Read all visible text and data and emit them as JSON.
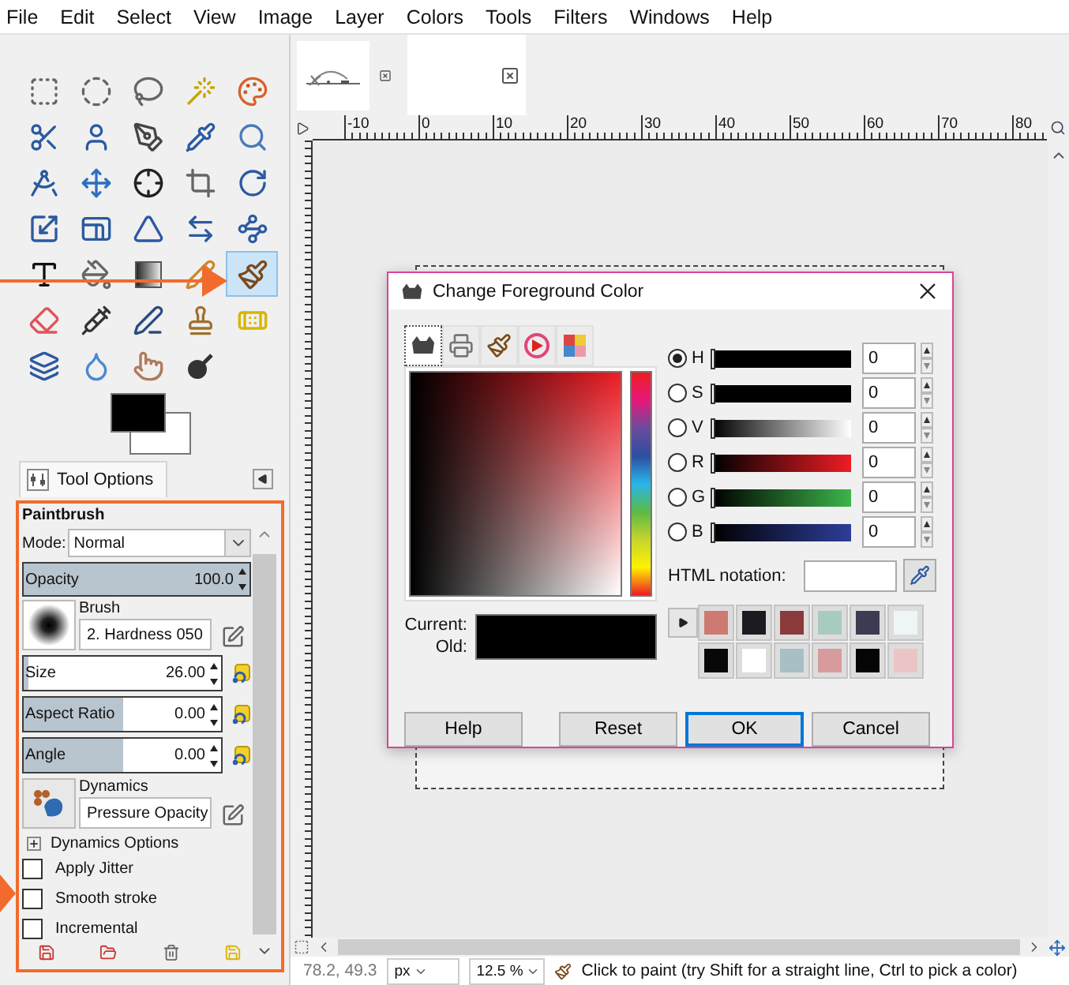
{
  "menu_bar": [
    "File",
    "Edit",
    "Select",
    "View",
    "Image",
    "Layer",
    "Colors",
    "Tools",
    "Filters",
    "Windows",
    "Help"
  ],
  "toolbox": {
    "tools": [
      {
        "selected": false
      },
      {
        "selected": false
      },
      {
        "selected": false
      },
      {
        "selected": false
      },
      {
        "selected": false
      },
      {
        "selected": false
      },
      {
        "selected": false
      },
      {
        "selected": false
      },
      {
        "selected": false
      },
      {
        "selected": false
      },
      {
        "selected": false
      },
      {
        "selected": false
      },
      {
        "selected": false
      },
      {
        "selected": false
      },
      {
        "selected": false
      },
      {
        "selected": false
      },
      {
        "selected": false
      },
      {
        "selected": false
      },
      {
        "selected": false
      },
      {
        "selected": false
      },
      {
        "selected": false
      },
      {
        "selected": false
      },
      {
        "selected": false
      },
      {
        "selected": false
      },
      {
        "selected": true
      },
      {
        "selected": false
      },
      {
        "selected": false
      },
      {
        "selected": false
      },
      {
        "selected": false
      },
      {
        "selected": false
      },
      {
        "selected": false
      },
      {
        "selected": false
      },
      {
        "selected": false
      },
      {
        "selected": false
      }
    ]
  },
  "dock_tab": {
    "label": "Tool Options"
  },
  "tool_options": {
    "title": "Paintbrush",
    "mode_label": "Mode:",
    "mode": "Normal",
    "opacity": {
      "label": "Opacity",
      "value": "100.0",
      "level": 1
    },
    "brush_label": "Brush",
    "brush": "2. Hardness 050",
    "brush_sliders": [
      {
        "label": "Size",
        "value": "26.00",
        "level": 0.02
      },
      {
        "label": "Aspect Ratio",
        "value": "0.00",
        "level": 0.5
      },
      {
        "label": "Angle",
        "value": "0.00",
        "level": 0.5
      }
    ],
    "dynamics_label": "Dynamics",
    "dynamics": "Pressure Opacity",
    "dynamics_options": {
      "label": "Dynamics Options",
      "expanded": false
    },
    "checkboxes": [
      {
        "label": "Apply Jitter",
        "checked": false
      },
      {
        "label": "Smooth stroke",
        "checked": false
      },
      {
        "label": "Incremental",
        "checked": false
      }
    ]
  },
  "image_tabs": [
    {
      "selected": false
    },
    {
      "selected": true
    }
  ],
  "ruler": {
    "labels": [
      "-10",
      "0",
      "10",
      "20",
      "30",
      "40",
      "50",
      "60",
      "70",
      "80"
    ]
  },
  "color_dialog": {
    "title": "Change Foreground Color",
    "selector_tabs": [
      {
        "selected": true
      },
      {
        "selected": false
      },
      {
        "selected": false
      },
      {
        "selected": false
      },
      {
        "selected": false
      }
    ],
    "current_label": "Current:",
    "old_label": "Old:",
    "channels": [
      {
        "label": "H",
        "selected": true,
        "value": "0",
        "level": 0
      },
      {
        "label": "S",
        "selected": false,
        "value": "0",
        "level": 0
      },
      {
        "label": "V",
        "selected": false,
        "value": "0",
        "level": 0
      },
      {
        "label": "R",
        "selected": false,
        "value": "0",
        "level": 0
      },
      {
        "label": "G",
        "selected": false,
        "value": "0",
        "level": 0
      },
      {
        "label": "B",
        "selected": false,
        "value": "0",
        "level": 0
      }
    ],
    "html_label": "HTML notation:",
    "history": [
      {
        "color": "#cd7a70"
      },
      {
        "color": "#1e1a22"
      },
      {
        "color": "#8b3a3c"
      },
      {
        "color": "#a8cbbf"
      },
      {
        "color": "#3b3c52"
      },
      {
        "color": "#eef5f7"
      },
      {
        "color": "#080808"
      },
      {
        "color": "#ffffff"
      },
      {
        "color": "#a7bfc5"
      },
      {
        "color": "#d89b9d"
      },
      {
        "color": "#050505"
      },
      {
        "color": "#ebc5c5"
      }
    ],
    "buttons": [
      {
        "label": "Help",
        "kind": "normal"
      },
      {
        "label": "Reset",
        "kind": "normal"
      },
      {
        "label": "OK",
        "kind": "default"
      },
      {
        "label": "Cancel",
        "kind": "normal"
      }
    ]
  },
  "status_bar": {
    "coordinates": "78.2, 49.3",
    "unit": "px",
    "zoom": "12.5 %",
    "message": "Click to paint (try Shift for a straight line, Ctrl to pick a color)"
  }
}
